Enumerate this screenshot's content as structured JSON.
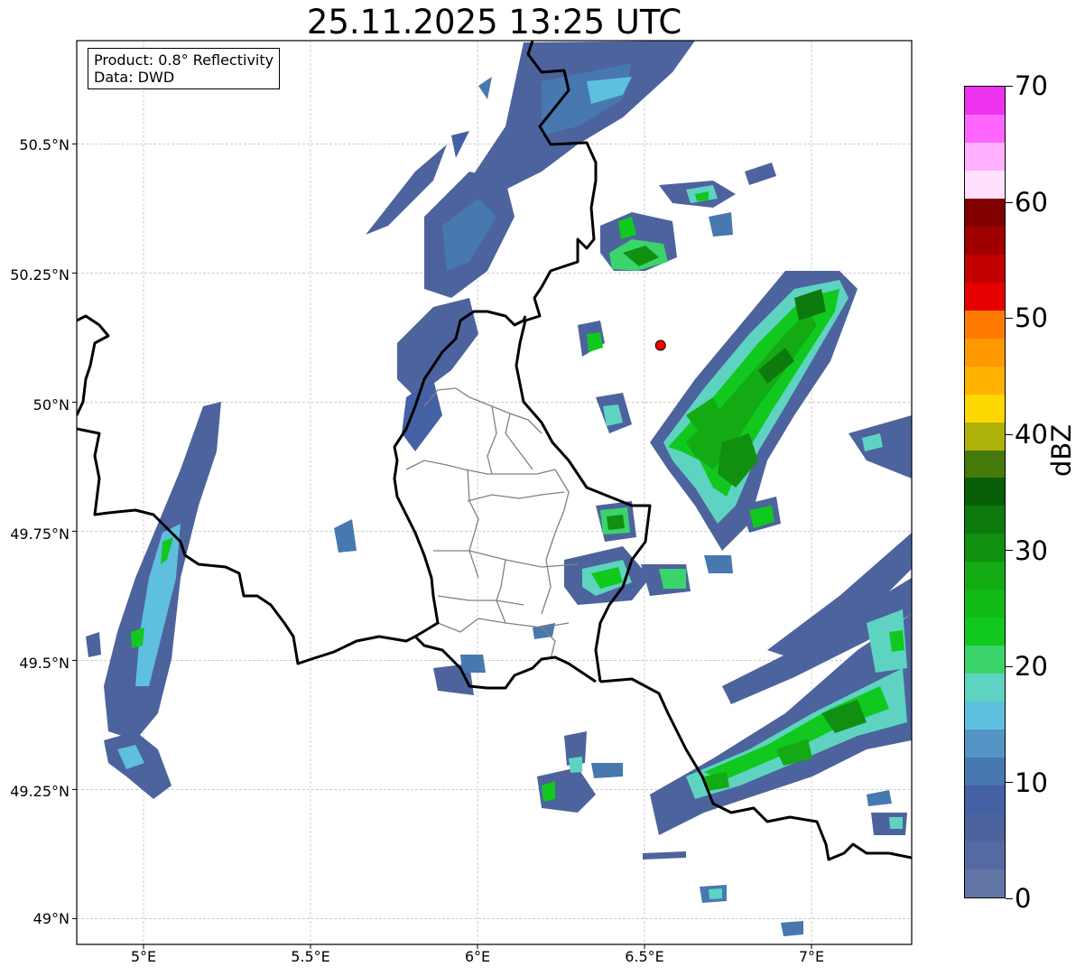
{
  "title": "25.11.2025 13:25 UTC",
  "info": {
    "product": "Product: 0.8° Reflectivity",
    "source": "Data: DWD"
  },
  "axes": {
    "lat_labels": [
      "50.5°N",
      "50.25°N",
      "50°N",
      "49.75°N",
      "49.5°N",
      "49.25°N",
      "49°N"
    ],
    "lon_labels": [
      "5°E",
      "5.5°E",
      "6°E",
      "6.5°E",
      "7°E"
    ],
    "lat_range": [
      48.95,
      50.7
    ],
    "lon_range": [
      4.8,
      7.3
    ],
    "grid": true
  },
  "radar_site": {
    "lat": 50.11,
    "lon": 6.548,
    "marker": "red-dot"
  },
  "colorbar": {
    "unit": "dBZ",
    "min": 0,
    "max": 70,
    "tick_labels": [
      "0",
      "10",
      "20",
      "30",
      "40",
      "50",
      "60",
      "70"
    ],
    "colors": [
      "#6375a6",
      "#5569a2",
      "#4c639e",
      "#4461a6",
      "#4778b0",
      "#5394c4",
      "#5ec0de",
      "#5fd3c2",
      "#3bd46b",
      "#10c81e",
      "#12bb15",
      "#13aa13",
      "#108f10",
      "#0c7a0c",
      "#075e07",
      "#457a0a",
      "#adb10a",
      "#ffd700",
      "#ffb300",
      "#ff9900",
      "#ff7a00",
      "#e60000",
      "#c20000",
      "#a10000",
      "#800000",
      "#ffe0ff",
      "#ffb0ff",
      "#ff66ff",
      "#ee33ee"
    ]
  },
  "palette": {
    "border_country": "#000000",
    "border_region": "#808080",
    "radar_dot": "#ff0000",
    "gridline": "#bbbbbb"
  }
}
